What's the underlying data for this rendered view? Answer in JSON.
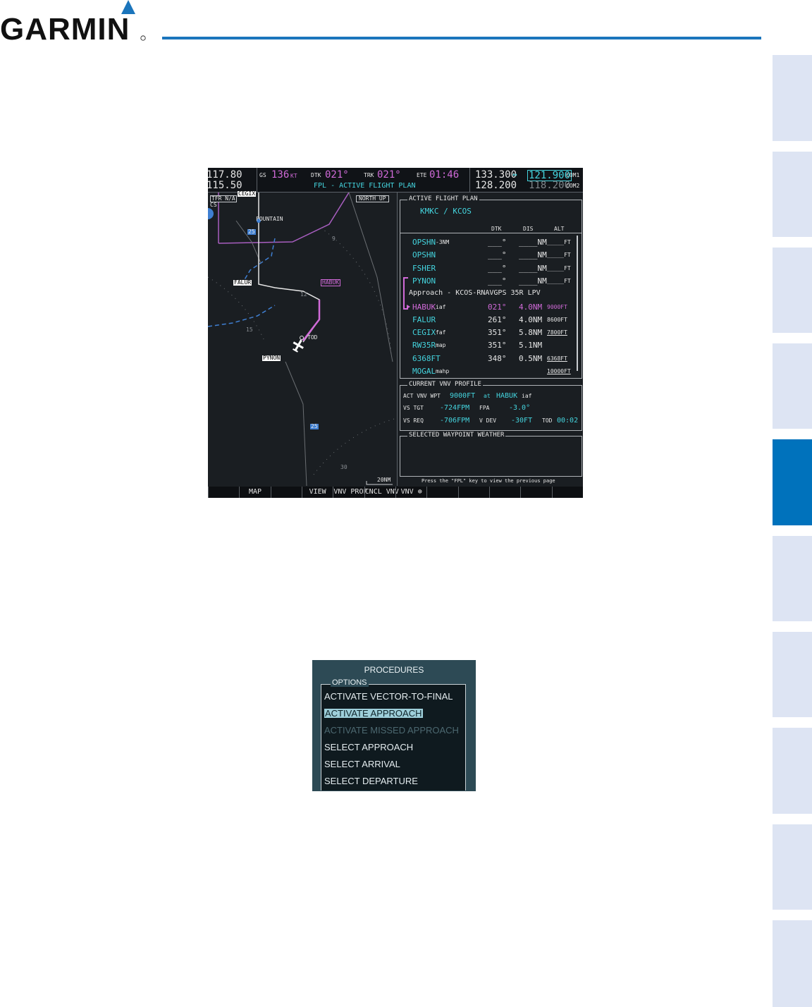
{
  "header": {
    "brand": "GARMIN",
    "accent_color": "#1b75bc"
  },
  "side_tabs": {
    "count": 10,
    "active_index": 4,
    "active_color": "#0072bc",
    "inactive_color": "#dde4f3"
  },
  "mfd": {
    "nav": {
      "freq_1": "117.80",
      "freq_2": "115.50"
    },
    "top": {
      "gs_label": "GS",
      "gs_value": "136",
      "gs_unit": "KT",
      "dtk_label": "DTK",
      "dtk_value": "021°",
      "trk_label": "TRK",
      "trk_value": "021°",
      "ete_label": "ETE",
      "ete_value": "01:46",
      "page_title": "FPL - ACTIVE FLIGHT PLAN"
    },
    "com": {
      "active_1": "133.300",
      "arrow": "↔",
      "standby_1": "121.900",
      "label_1": "COM1",
      "active_2": "128.200",
      "standby_2": "118.200",
      "label_2": "COM2"
    },
    "map": {
      "tfr": "TFR N/A",
      "cs": "CS",
      "north_up": "NORTH UP",
      "labels": {
        "cegix": "CEGIX",
        "fountain": "FOUNTAIN",
        "falur": "FALUR",
        "habuk": "HABUK",
        "pynon": "PYNON",
        "tod": "TOD",
        "highway_25": "25",
        "highway_25b": "25"
      },
      "compass": {
        "n9": "9",
        "n12": "12",
        "n15": "15",
        "n30": "30"
      },
      "range": "20NM"
    },
    "flight_plan": {
      "title": "ACTIVE FLIGHT PLAN",
      "route": "KMKC / KCOS",
      "col_dtk": "DTK",
      "col_dis": "DIS",
      "col_alt": "ALT",
      "rows": [
        {
          "wpt": "OPSHN",
          "suffix": " -3NM",
          "dtk": "___°",
          "dis": "____NM",
          "alt": "_____FT",
          "alt_ul": false
        },
        {
          "wpt": "OPSHN",
          "suffix": "",
          "dtk": "___°",
          "dis": "____NM",
          "alt": "_____FT",
          "alt_ul": false
        },
        {
          "wpt": "FSHER",
          "suffix": "",
          "dtk": "___°",
          "dis": "____NM",
          "alt": "_____FT",
          "alt_ul": false
        },
        {
          "wpt": "PYNON",
          "suffix": "",
          "dtk": "___°",
          "dis": "____NM",
          "alt": "_____FT",
          "alt_ul": false
        },
        {
          "wpt": "Approach - KCOS-RNAVGPS 35R LPV",
          "suffix": "",
          "dtk": "",
          "dis": "",
          "alt": "",
          "alt_ul": false
        },
        {
          "wpt": "HABUK",
          "suffix": " iaf",
          "dtk": "021°",
          "dis": "4.0NM",
          "alt": "9000FT",
          "alt_ul": false
        },
        {
          "wpt": "FALUR",
          "suffix": "",
          "dtk": "261°",
          "dis": "4.0NM",
          "alt": "8600FT",
          "alt_ul": false
        },
        {
          "wpt": "CEGIX",
          "suffix": " faf",
          "dtk": "351°",
          "dis": "5.8NM",
          "alt": "7800FT",
          "alt_ul": true
        },
        {
          "wpt": "RW35R",
          "suffix": " map",
          "dtk": "351°",
          "dis": "5.1NM",
          "alt": "",
          "alt_ul": false
        },
        {
          "wpt": "6368FT",
          "suffix": "",
          "dtk": "348°",
          "dis": "0.5NM",
          "alt": "6368FT",
          "alt_ul": true
        },
        {
          "wpt": "MOGAL",
          "suffix": " mahp",
          "dtk": "",
          "dis": "",
          "alt": "10000FT",
          "alt_ul": true
        }
      ]
    },
    "vnv": {
      "title": "CURRENT VNV PROFILE",
      "act_label": "ACT VNV WPT",
      "act_alt": "9000FT",
      "at": "at",
      "act_wpt": "HABUK",
      "act_suffix": "iaf",
      "vs_tgt_label": "VS TGT",
      "vs_tgt": "-724FPM",
      "fpa_label": "FPA",
      "fpa": "-3.0°",
      "vs_req_label": "VS REQ",
      "vs_req": "-706FPM",
      "vdev_label": "V DEV",
      "vdev": "-30FT",
      "tod_label": "TOD",
      "tod": "00:02"
    },
    "weather": {
      "title": "SELECTED WAYPOINT WEATHER",
      "hint": "Press the \"FPL\" key to view the previous page"
    },
    "softkeys": [
      {
        "label": "",
        "dim": false
      },
      {
        "label": "MAP",
        "dim": false
      },
      {
        "label": "",
        "dim": true
      },
      {
        "label": "VIEW",
        "dim": false
      },
      {
        "label": "VNV PROF",
        "dim": false
      },
      {
        "label": "CNCL VNV",
        "dim": false
      },
      {
        "label": "VNV ⊕",
        "dim": false
      },
      {
        "label": "",
        "dim": true
      },
      {
        "label": "",
        "dim": true
      },
      {
        "label": "",
        "dim": true
      },
      {
        "label": "",
        "dim": true
      },
      {
        "label": "",
        "dim": true
      }
    ]
  },
  "procedures": {
    "title": "PROCEDURES",
    "options_label": "OPTIONS",
    "options": [
      {
        "label": "ACTIVATE VECTOR-TO-FINAL",
        "state": "normal"
      },
      {
        "label": "ACTIVATE APPROACH",
        "state": "selected"
      },
      {
        "label": "ACTIVATE MISSED APPROACH",
        "state": "disabled"
      },
      {
        "label": "SELECT APPROACH",
        "state": "normal"
      },
      {
        "label": "SELECT ARRIVAL",
        "state": "normal"
      },
      {
        "label": "SELECT DEPARTURE",
        "state": "normal"
      }
    ]
  }
}
